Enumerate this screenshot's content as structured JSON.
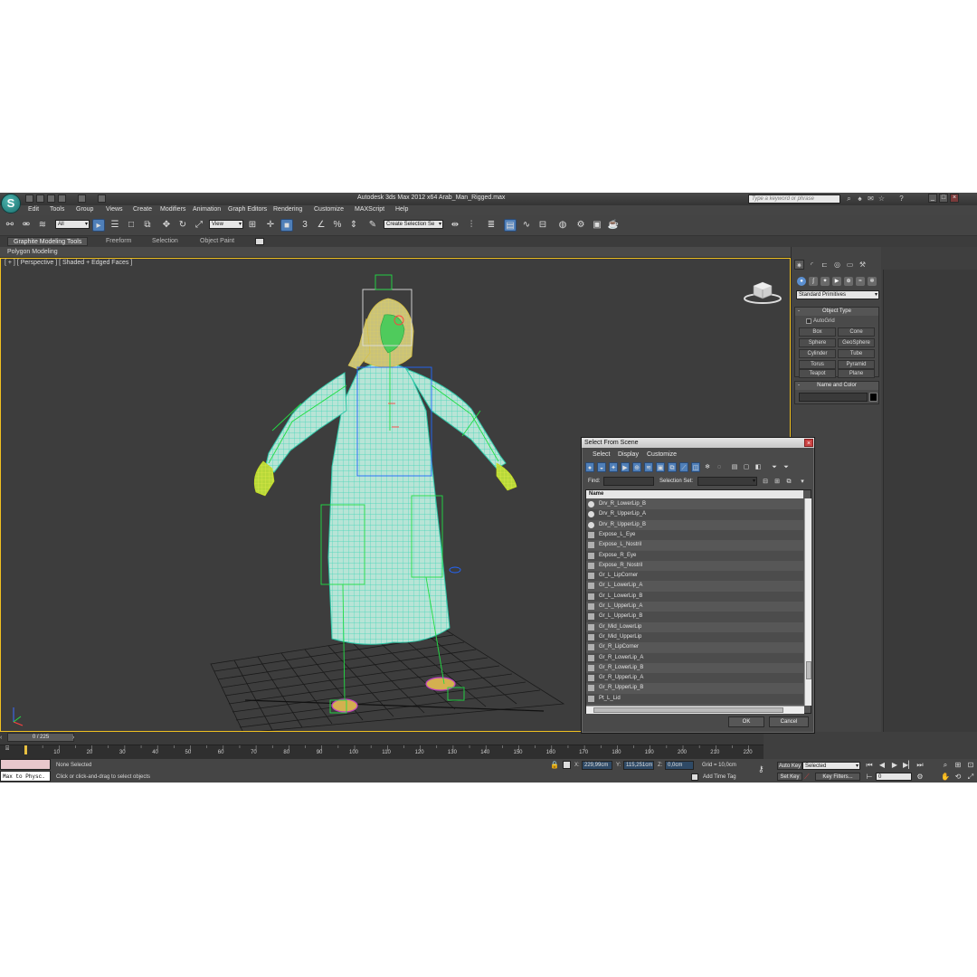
{
  "window": {
    "title": "Autodesk 3ds Max  2012 x64     Arab_Man_Rigged.max",
    "search_placeholder": "Type a keyword or phrase"
  },
  "menus": [
    "Edit",
    "Tools",
    "Group",
    "Views",
    "Create",
    "Modifiers",
    "Animation",
    "Graph Editors",
    "Rendering",
    "Customize",
    "MAXScript",
    "Help"
  ],
  "toolbar": {
    "filter_value": "All",
    "refcoord_value": "View",
    "named_selection_value": "Create Selection Se"
  },
  "ribbon": {
    "tabs": [
      "Graphite Modeling Tools",
      "Freeform",
      "Selection",
      "Object Paint"
    ],
    "panel_label": "Polygon Modeling"
  },
  "viewport": {
    "label": "[ + ] [ Perspective ] [ Shaded + Edged Faces ]"
  },
  "command_panel": {
    "category": "Standard Primitives",
    "object_type_title": "Object Type",
    "autogrid_label": "AutoGrid",
    "primitives": [
      "Box",
      "Cone",
      "Sphere",
      "GeoSphere",
      "Cylinder",
      "Tube",
      "Torus",
      "Pyramid",
      "Teapot",
      "Plane"
    ],
    "name_color_title": "Name and Color",
    "object_color": "#000000"
  },
  "timeline": {
    "slider": "0 / 225",
    "ticks": [
      "10",
      "20",
      "30",
      "40",
      "50",
      "60",
      "70",
      "80",
      "90",
      "100",
      "110",
      "120",
      "130",
      "140",
      "150",
      "160",
      "170",
      "180",
      "190",
      "200",
      "210",
      "220"
    ]
  },
  "status": {
    "maxscript": "Max to Physc.",
    "selection": "None Selected",
    "prompt": "Click or click-and-drag to select objects",
    "x_label": "X:",
    "x": "229,99cm",
    "y_label": "Y:",
    "y": "115,251cm",
    "z_label": "Z:",
    "z": "0,0cm",
    "grid": "Grid = 10,0cm",
    "add_time_tag": "Add Time Tag",
    "auto_key": "Auto Key",
    "key_mode": "Selected",
    "set_key": "Set Key",
    "key_filters": "Key Filters...",
    "frame": "0"
  },
  "dialog": {
    "title": "Select From Scene",
    "menus": [
      "Select",
      "Display",
      "Customize"
    ],
    "find_label": "Find:",
    "selection_set_label": "Selection Set:",
    "list_header": "Name",
    "items": [
      "Drv_R_LowerLip_B",
      "Drv_R_UpperLip_A",
      "Drv_R_UpperLip_B",
      "Expose_L_Eye",
      "Expose_L_Nostril",
      "Expose_R_Eye",
      "Expose_R_Nostril",
      "Gr_L_LipCorner",
      "Gr_L_LowerLip_A",
      "Gr_L_LowerLip_B",
      "Gr_L_UpperLip_A",
      "Gr_L_UpperLip_B",
      "Gr_Mid_LowerLip",
      "Gr_Mid_UpperLip",
      "Gr_R_LipCorner",
      "Gr_R_LowerLip_A",
      "Gr_R_LowerLip_B",
      "Gr_R_UpperLip_A",
      "Gr_R_UpperLip_B",
      "Pt_L_Lid"
    ],
    "ok_label": "OK",
    "cancel_label": "Cancel"
  },
  "colors": {
    "accent": "#4f7fb8",
    "viewport_border": "#f0c020",
    "mesh": "#7fe6d0",
    "rig": "#22dd44"
  }
}
